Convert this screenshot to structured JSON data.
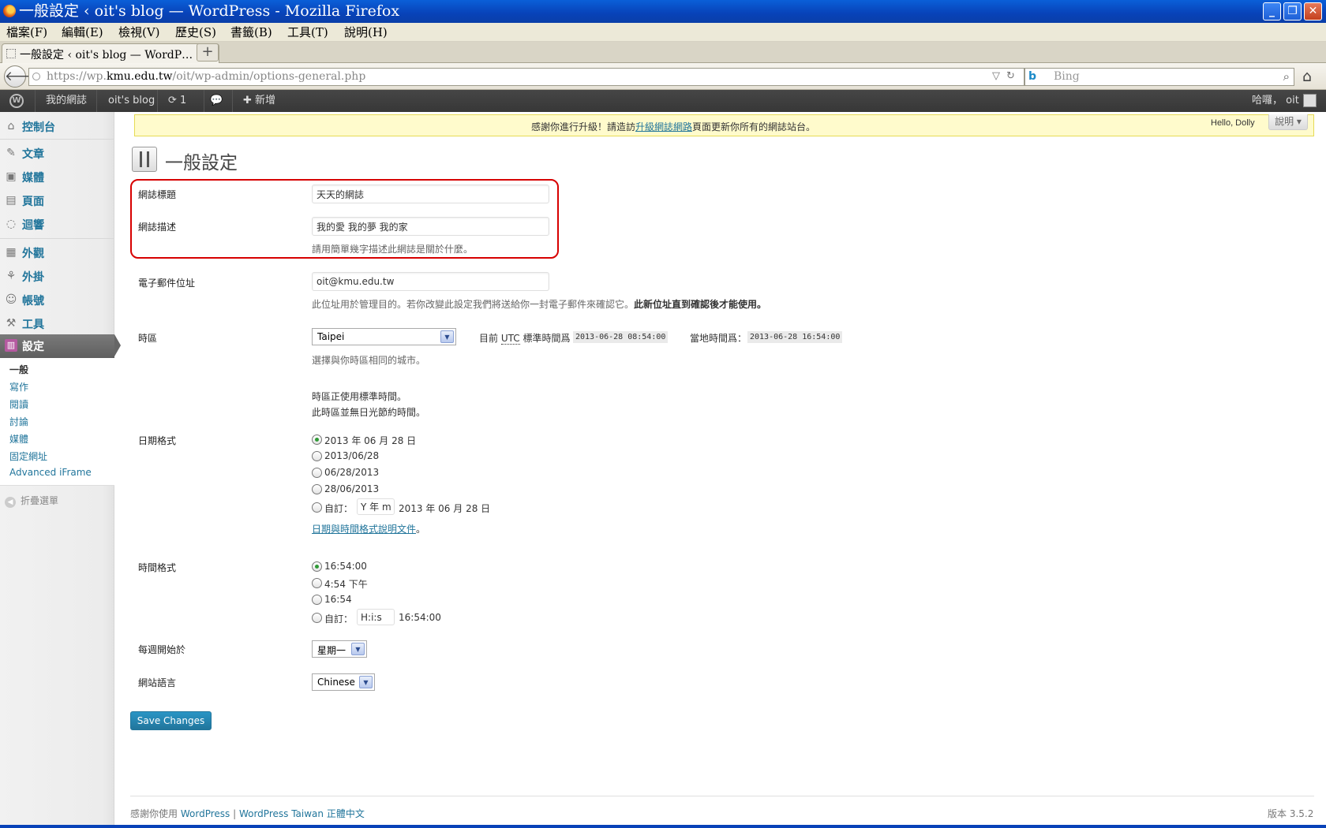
{
  "window": {
    "title": "一般設定 ‹ oit's blog — WordPress - Mozilla Firefox",
    "minimize": "_",
    "restore": "❐",
    "close": "✕"
  },
  "menubar": [
    "檔案(F)",
    "編輯(E)",
    "檢視(V)",
    "歷史(S)",
    "書籤(B)",
    "工具(T)",
    "說明(H)"
  ],
  "tab": {
    "title": "一般設定 ‹ oit's blog — WordP…",
    "new_tab": "+"
  },
  "nav": {
    "url_prefix": "https://wp.",
    "url_domain": "kmu.edu.tw",
    "url_path": "/oit/wp-admin/options-general.php",
    "search_engine": "b",
    "search_placeholder": "Bing"
  },
  "adminbar": {
    "my_sites": "我的網誌",
    "site_name": "oit's blog",
    "updates_count": "1",
    "new_label": "新增",
    "howdy": "哈囉， oit"
  },
  "sidebar": {
    "items": [
      {
        "label": "控制台",
        "icon": "dashboard-icon"
      },
      {
        "label": "文章",
        "icon": "pin-icon"
      },
      {
        "label": "媒體",
        "icon": "media-icon"
      },
      {
        "label": "頁面",
        "icon": "page-icon"
      },
      {
        "label": "迴響",
        "icon": "comment-icon"
      },
      {
        "label": "外觀",
        "icon": "appearance-icon"
      },
      {
        "label": "外掛",
        "icon": "plugin-icon"
      },
      {
        "label": "帳號",
        "icon": "users-icon"
      },
      {
        "label": "工具",
        "icon": "tools-icon"
      },
      {
        "label": "設定",
        "icon": "settings-icon"
      }
    ],
    "submenu": [
      "一般",
      "寫作",
      "閱讀",
      "討論",
      "媒體",
      "固定網址",
      "Advanced iFrame"
    ],
    "collapse": "折疊選單"
  },
  "notice": {
    "before": "感謝你進行升級！請造訪",
    "link": "升級網誌網路",
    "after": "頁面更新你所有的網誌站台。"
  },
  "hello_dolly": "Hello, Dolly",
  "help_button": "說明 ▾",
  "page_title": "一般設定",
  "form": {
    "blog_title_label": "網誌標題",
    "blog_title_value": "天天的網誌",
    "tagline_label": "網誌描述",
    "tagline_value": "我的愛 我的夢 我的家",
    "tagline_desc": "請用簡單幾字描述此網誌是關於什麼。",
    "email_label": "電子郵件位址",
    "email_value": "oit@kmu.edu.tw",
    "email_desc": "此位址用於管理目的。若你改變此設定我們將送給你一封電子郵件來確認它。",
    "email_desc_bold": "此新位址直到確認後才能使用。",
    "timezone_label": "時區",
    "timezone_value": "Taipei",
    "utc_prefix": "目前",
    "utc_abbr": "UTC",
    "utc_suffix": "標準時間爲",
    "utc_time": "2013-06-28 08:54:00",
    "local_label": "當地時間爲：",
    "local_time": "2013-06-28 16:54:00",
    "timezone_desc": "選擇與你時區相同的城市。",
    "std_time_note": "時區正使用標準時間。",
    "no_dst_note": "此時區並無日光節約時間。",
    "date_format_label": "日期格式",
    "date_formats": [
      "2013 年 06 月 28 日",
      "2013/06/28",
      "06/28/2013",
      "28/06/2013"
    ],
    "custom_label": "自訂：",
    "date_custom_value": "Y 年 m 月",
    "date_custom_preview": "2013 年 06 月 28 日",
    "date_doc_link": "日期與時間格式說明文件",
    "date_doc_suffix": "。",
    "time_format_label": "時間格式",
    "time_formats": [
      "16:54:00",
      "4:54 下午",
      "16:54"
    ],
    "time_custom_value": "H:i:s",
    "time_custom_preview": "16:54:00",
    "week_start_label": "每週開始於",
    "week_start_value": "星期一",
    "language_label": "網站語言",
    "language_value": "Chinese",
    "save_label": "Save Changes"
  },
  "footer": {
    "thanks": "感謝你使用",
    "wp_link": "WordPress",
    "sep": " | ",
    "tw_link": "WordPress Taiwan 正體中文",
    "version": "版本 3.5.2"
  }
}
